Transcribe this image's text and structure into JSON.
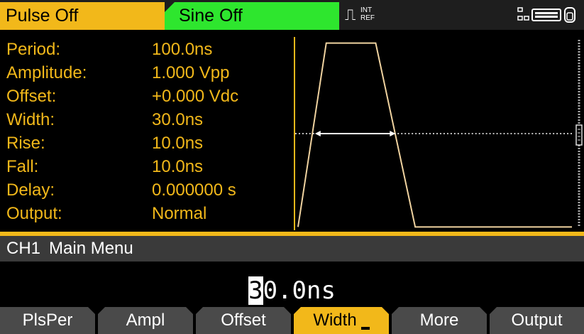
{
  "header": {
    "ch1_tab": "Pulse Off",
    "ch2_tab": "Sine Off",
    "trigger": {
      "int": "INT",
      "ref": "REF"
    }
  },
  "params": [
    {
      "label": "Period:",
      "value": "100.0ns"
    },
    {
      "label": "Amplitude:",
      "value": "1.000  Vpp"
    },
    {
      "label": "Offset:",
      "value": "+0.000  Vdc"
    },
    {
      "label": "Width:",
      "value": "30.0ns"
    },
    {
      "label": "Rise:",
      "value": "10.0ns"
    },
    {
      "label": "Fall:",
      "value": "10.0ns"
    },
    {
      "label": "Delay:",
      "value": "0.000000  s"
    },
    {
      "label": "Output:",
      "value": "Normal"
    }
  ],
  "menu": {
    "channel": "CH1",
    "title": "Main  Menu"
  },
  "edit": {
    "cursor_digit": "3",
    "rest": "0.0ns"
  },
  "softkeys": [
    {
      "label": "PlsPer",
      "active": false
    },
    {
      "label": "Ampl",
      "active": false
    },
    {
      "label": "Offset",
      "active": false
    },
    {
      "label": "Width",
      "active": true
    },
    {
      "label": "More",
      "active": false
    },
    {
      "label": "Output",
      "active": false
    }
  ],
  "colors": {
    "ch1": "#f2b81a",
    "ch2": "#2ee62e",
    "menu_bar": "#3a3a3a",
    "softkey": "#4a4a4a"
  }
}
